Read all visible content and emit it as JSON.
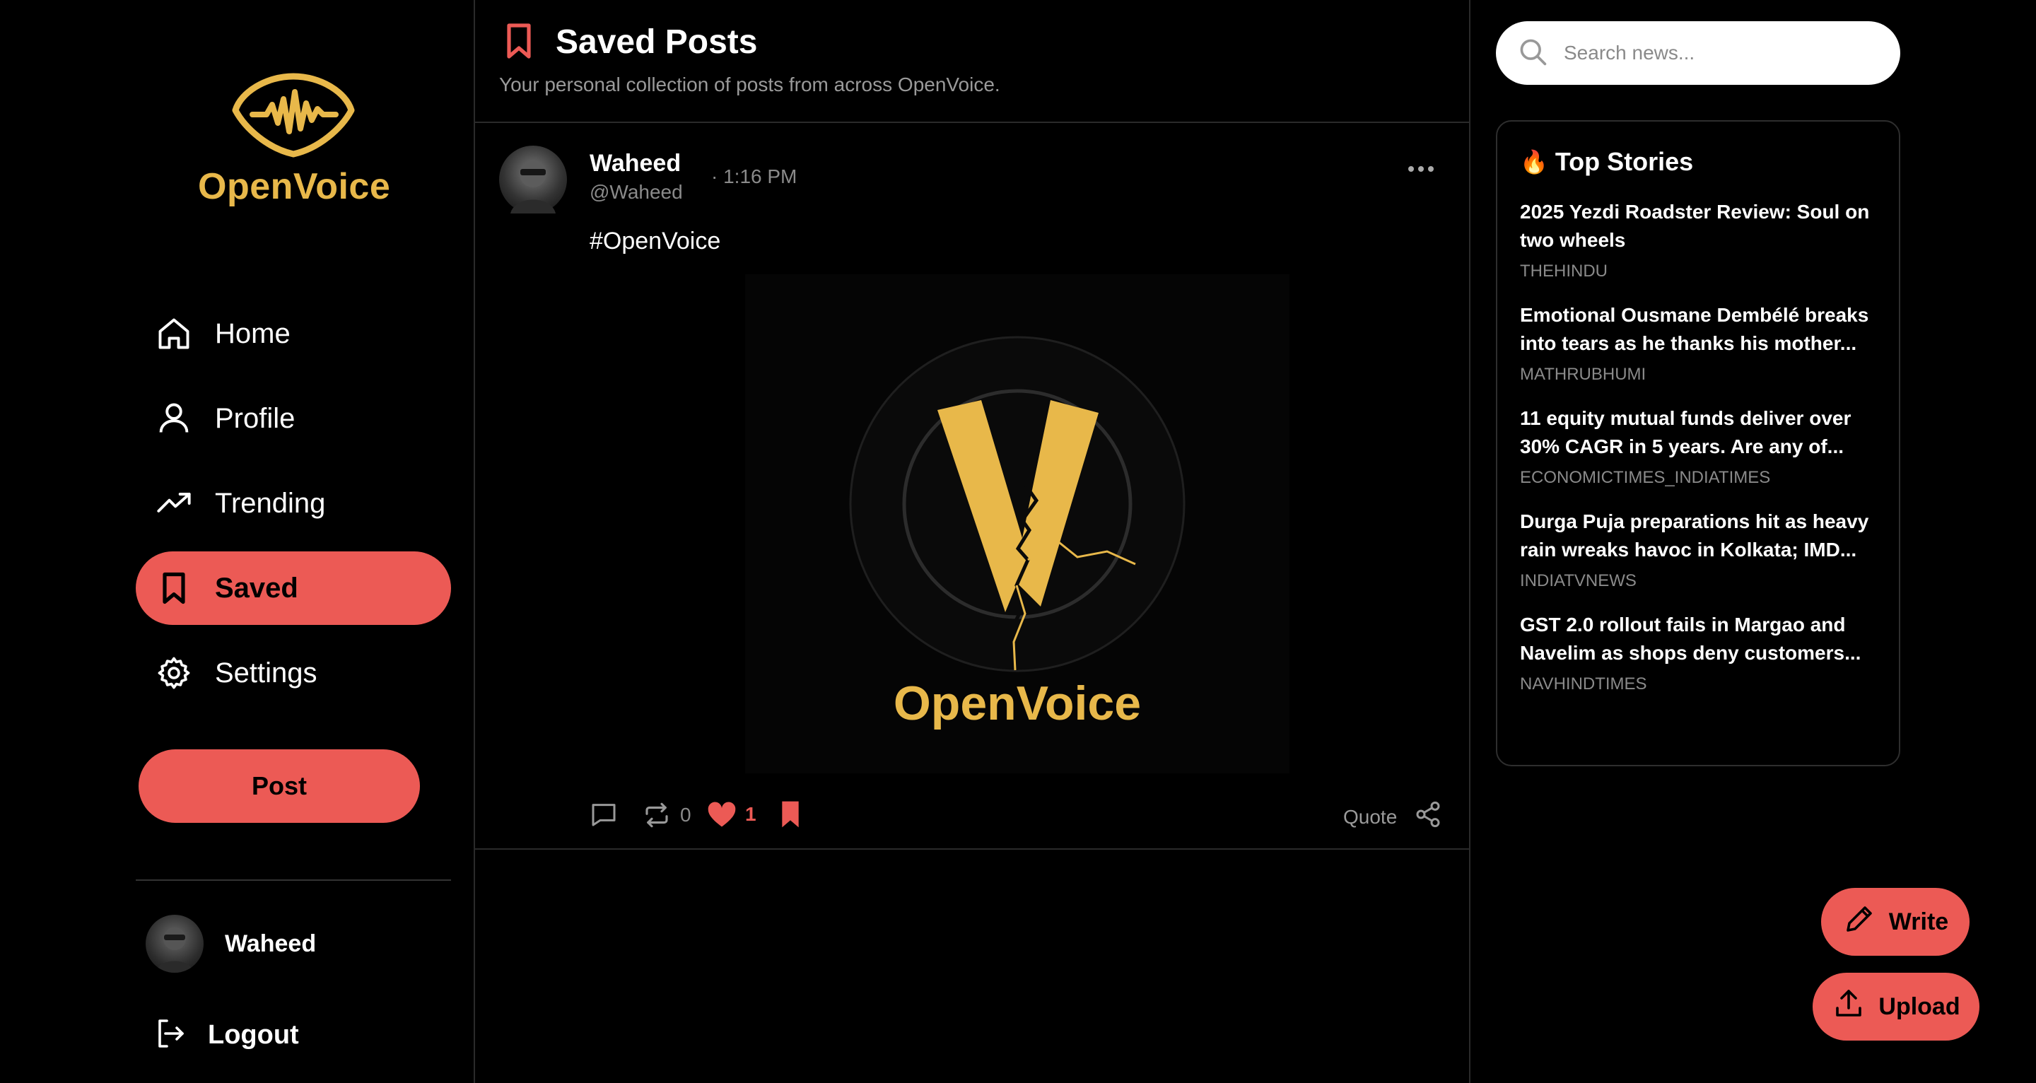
{
  "brand": {
    "name": "OpenVoice",
    "accent": "#ec5a55",
    "gold": "#e8b84a"
  },
  "sidebar": {
    "nav": [
      {
        "label": "Home",
        "icon": "home-icon"
      },
      {
        "label": "Profile",
        "icon": "user-icon"
      },
      {
        "label": "Trending",
        "icon": "trending-icon"
      },
      {
        "label": "Saved",
        "icon": "bookmark-icon",
        "active": true
      },
      {
        "label": "Settings",
        "icon": "gear-icon"
      }
    ],
    "post_label": "Post",
    "user": {
      "name": "Waheed"
    },
    "logout_label": "Logout"
  },
  "main": {
    "title": "Saved Posts",
    "subtitle": "Your personal collection of posts from across OpenVoice.",
    "post": {
      "author": "Waheed",
      "handle": "@Waheed",
      "time": "· 1:16 PM",
      "text": "#OpenVoice",
      "image_brand": "OpenVoice",
      "reposts": "0",
      "likes": "1",
      "quote_label": "Quote"
    }
  },
  "right": {
    "search_placeholder": "Search news...",
    "top_stories_title": "Top Stories",
    "stories": [
      {
        "title_lines": [
          "2025 Yezdi Roadster Review: Soul on",
          "two wheels"
        ],
        "source": "THEHINDU"
      },
      {
        "title_lines": [
          "Emotional Ousmane Dembélé breaks",
          "into tears as he thanks his mother..."
        ],
        "source": "MATHRUBHUMI"
      },
      {
        "title_lines": [
          "11 equity mutual funds deliver over",
          "30% CAGR in 5 years. Are any of..."
        ],
        "source": "ECONOMICTIMES_INDIATIMES"
      },
      {
        "title_lines": [
          "Durga Puja preparations hit as heavy",
          "rain wreaks havoc in Kolkata; IMD..."
        ],
        "source": "INDIATVNEWS"
      },
      {
        "title_lines": [
          "GST 2.0 rollout fails in Margao and",
          "Navelim as shops deny customers..."
        ],
        "source": "NAVHINDTIMES"
      }
    ]
  },
  "fabs": {
    "write_label": "Write",
    "upload_label": "Upload"
  }
}
